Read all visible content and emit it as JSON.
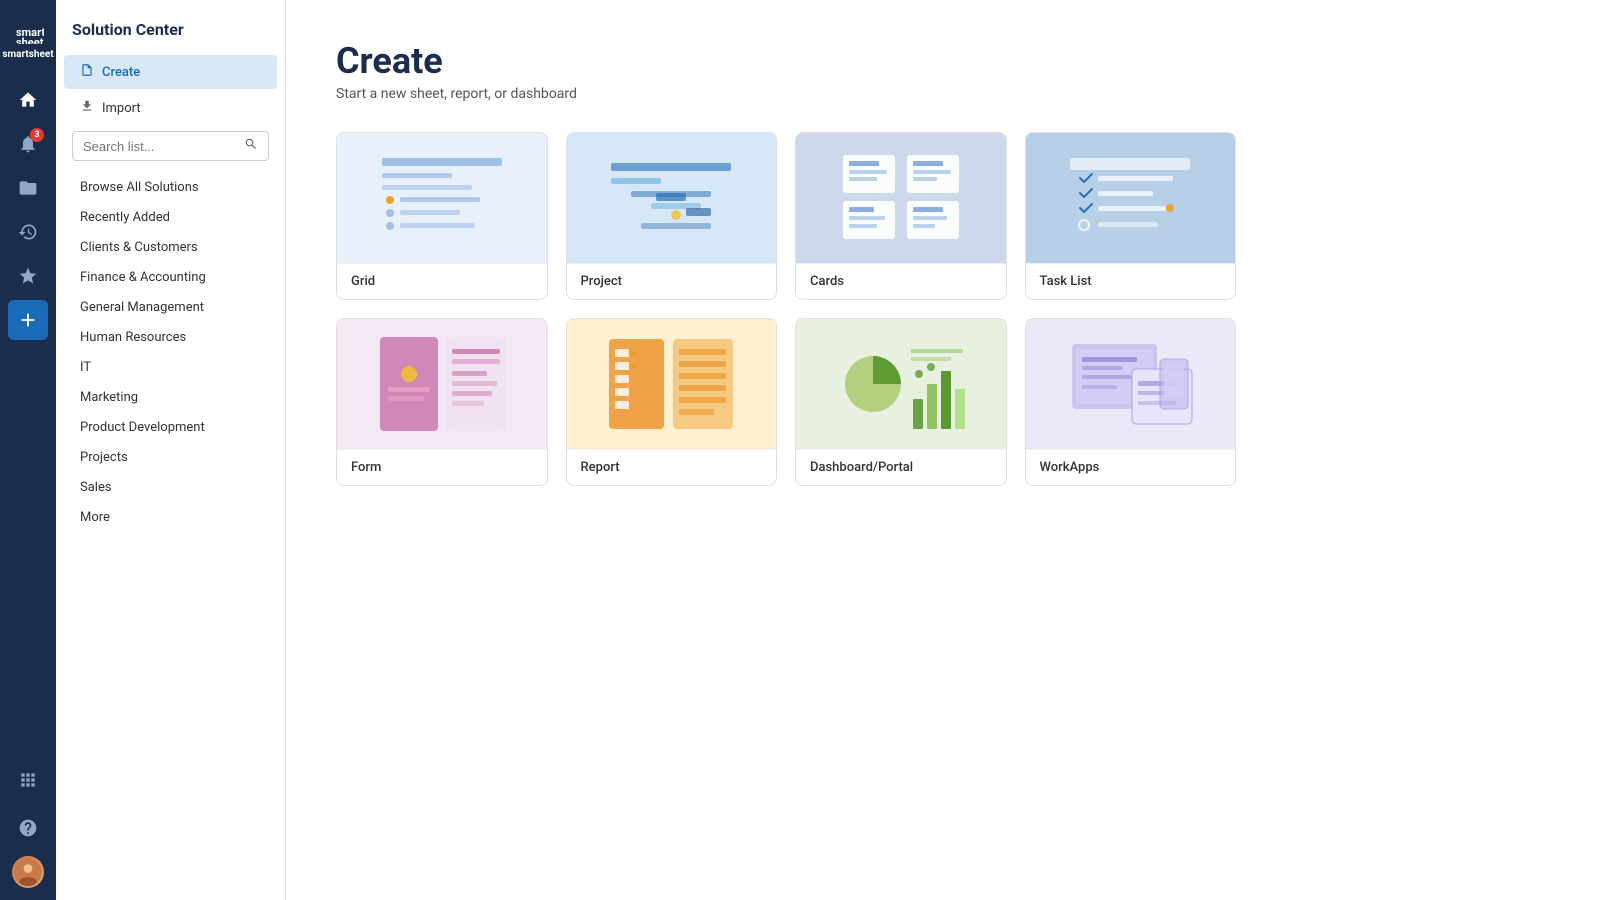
{
  "app": {
    "logo": "smartsheet"
  },
  "nav": {
    "icons": [
      {
        "name": "home-icon",
        "symbol": "⌂",
        "active": true
      },
      {
        "name": "notification-icon",
        "symbol": "🔔",
        "badge": "3"
      },
      {
        "name": "folder-icon",
        "symbol": "📁"
      },
      {
        "name": "clock-icon",
        "symbol": "🕐"
      },
      {
        "name": "star-icon",
        "symbol": "☆"
      },
      {
        "name": "add-icon",
        "symbol": "+",
        "special": true
      }
    ],
    "bottom": [
      {
        "name": "grid-icon",
        "symbol": "⊞"
      },
      {
        "name": "help-icon",
        "symbol": "?"
      }
    ]
  },
  "sidebar": {
    "title": "Solution Center",
    "nav_items": [
      {
        "label": "Create",
        "active": true,
        "icon": "📄"
      },
      {
        "label": "Import",
        "active": false,
        "icon": "⬇"
      }
    ],
    "search": {
      "placeholder": "Search list..."
    },
    "list_items": [
      {
        "label": "Browse All Solutions"
      },
      {
        "label": "Recently Added"
      },
      {
        "label": "Clients & Customers"
      },
      {
        "label": "Finance & Accounting"
      },
      {
        "label": "General Management"
      },
      {
        "label": "Human Resources"
      },
      {
        "label": "IT"
      },
      {
        "label": "Marketing"
      },
      {
        "label": "Product Development"
      },
      {
        "label": "Projects"
      },
      {
        "label": "Sales"
      },
      {
        "label": "More"
      }
    ]
  },
  "main": {
    "title": "Create",
    "subtitle": "Start a new sheet, report, or dashboard",
    "cards": [
      {
        "label": "Grid",
        "bg": "grid-card-bg"
      },
      {
        "label": "Project",
        "bg": "project-card-bg"
      },
      {
        "label": "Cards",
        "bg": "cards-card-bg"
      },
      {
        "label": "Task List",
        "bg": "tasklist-card-bg"
      },
      {
        "label": "Form",
        "bg": "form-card-bg"
      },
      {
        "label": "Report",
        "bg": "report-card-bg"
      },
      {
        "label": "Dashboard/Portal",
        "bg": "dashboard-card-bg"
      },
      {
        "label": "WorkApps",
        "bg": "workapps-card-bg"
      }
    ]
  }
}
